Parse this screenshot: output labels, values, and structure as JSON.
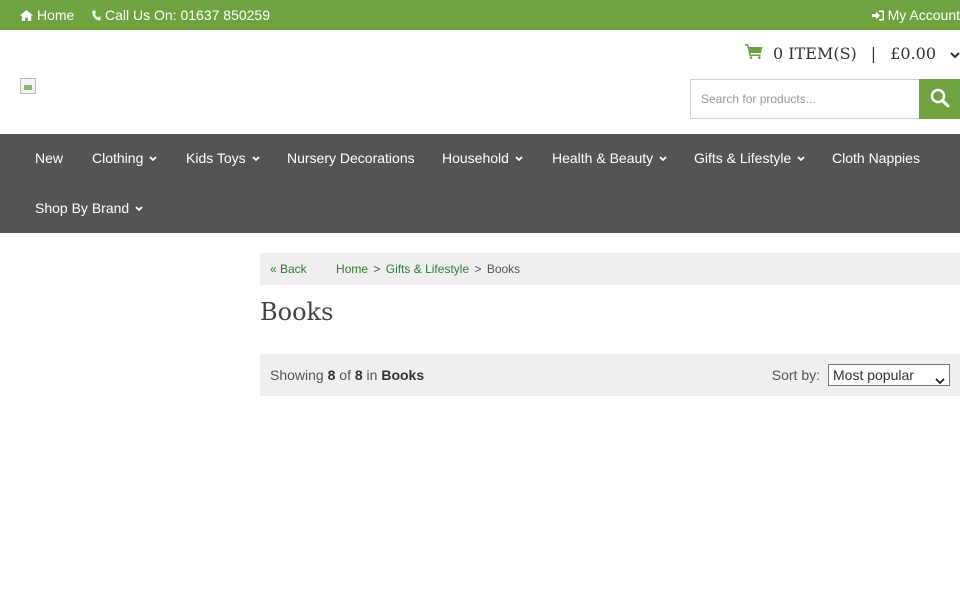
{
  "topbar": {
    "home_label": "Home",
    "phone_label": "Call Us On: 01637 850259",
    "account_label": "My Account",
    "bg_color": "#6ea33f"
  },
  "header": {
    "cart_count": "0 ITEM(S)",
    "cart_sep": "|",
    "cart_total": "£0.00",
    "search_placeholder": "Search for products..."
  },
  "nav": {
    "items": [
      {
        "label": "New"
      },
      {
        "label": "Clothing"
      },
      {
        "label": "Kids Toys"
      },
      {
        "label": "Nursery Decorations"
      },
      {
        "label": "Household"
      },
      {
        "label": "Health & Beauty"
      },
      {
        "label": "Gifts & Lifestyle"
      },
      {
        "label": "Cloth Nappies"
      },
      {
        "label": "Shop By Brand"
      }
    ],
    "bg_color": "#545454"
  },
  "breadcrumb": {
    "back": "« Back",
    "home": "Home",
    "sep": ">",
    "parent": "Gifts & Lifestyle",
    "current": "Books"
  },
  "main": {
    "title": "Books",
    "showing_prefix": "Showing",
    "showing_count": "8",
    "of_text": "of",
    "total_count": "8",
    "in_text": "in",
    "category": "Books",
    "sort_label": "Sort by:",
    "sort_value": "Most popular"
  }
}
